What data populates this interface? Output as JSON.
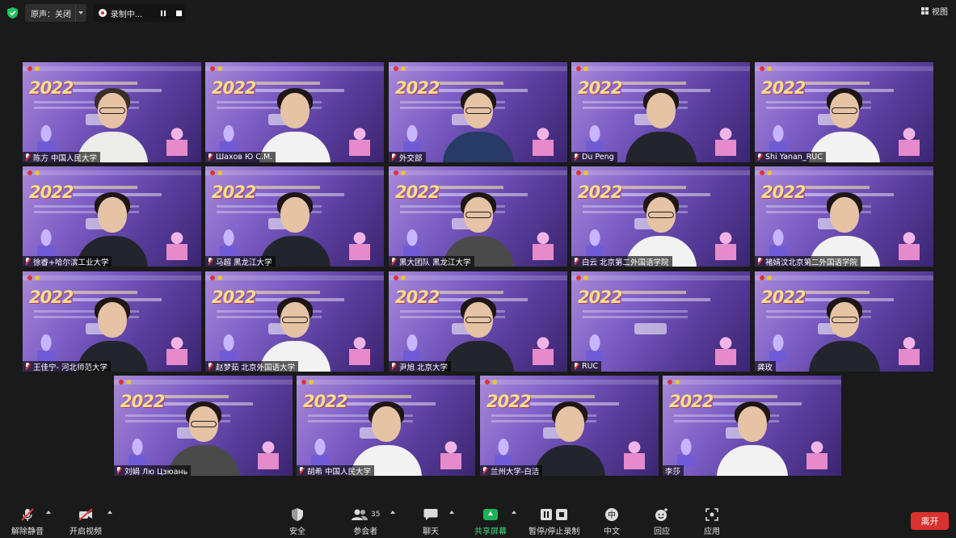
{
  "topbar": {
    "audio_label": "原声：关闭",
    "record_label": "录制中...",
    "view_label": "视图"
  },
  "participants": [
    {
      "name": "陈方 中国人民大学",
      "muted": true
    },
    {
      "name": "Шахов Ю С.М.",
      "muted": true
    },
    {
      "name": "外交部",
      "muted": true
    },
    {
      "name": "Du Peng",
      "muted": true
    },
    {
      "name": "Shi Yanan_RUC",
      "muted": true
    },
    {
      "name": "徐睿+哈尔滨工业大学",
      "muted": true
    },
    {
      "name": "马超 黑龙江大学",
      "muted": true
    },
    {
      "name": "黑大团队 黑龙江大学",
      "muted": true
    },
    {
      "name": "白云 北京第二外国语学院",
      "muted": true
    },
    {
      "name": "褚婧汶北京第二外国语学院",
      "muted": true
    },
    {
      "name": "王佳宁- 河北师范大学",
      "muted": true
    },
    {
      "name": "赵梦茹 北京外国语大学",
      "muted": true
    },
    {
      "name": "尹旭 北京大学",
      "muted": true
    },
    {
      "name": "RUC",
      "muted": true
    },
    {
      "name": "龚玫",
      "muted": false
    },
    {
      "name": "刘娟 Лю Цзюань",
      "muted": true
    },
    {
      "name": "胡希 中国人民大学",
      "muted": true
    },
    {
      "name": "兰州大学-白洁",
      "muted": true
    },
    {
      "name": "李莎",
      "muted": false
    }
  ],
  "toolbar": {
    "unmute": "解除静音",
    "start_video": "开启视频",
    "security": "安全",
    "participants": "参会者",
    "participants_count": "35",
    "chat": "聊天",
    "share_screen": "共享屏幕",
    "pause_stop_record": "暂停/停止录制",
    "chinese": "中文",
    "reactions": "回应",
    "apps": "应用",
    "leave": "离开"
  }
}
